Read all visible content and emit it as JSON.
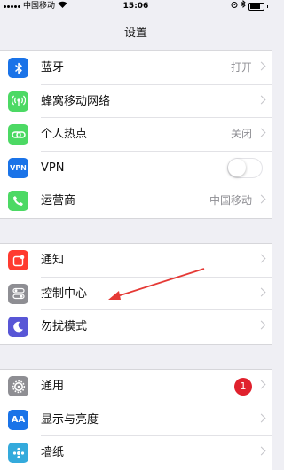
{
  "status_bar": {
    "carrier": "中国移动",
    "time": "15:06"
  },
  "nav": {
    "title": "设置"
  },
  "groups": [
    {
      "items": [
        {
          "label": "蓝牙",
          "value": "打开",
          "icon": "bluetooth-icon",
          "color": "#1a73e8"
        },
        {
          "label": "蜂窝移动网络",
          "value": "",
          "icon": "cellular-icon",
          "color": "#4cd964"
        },
        {
          "label": "个人热点",
          "value": "关闭",
          "icon": "hotspot-icon",
          "color": "#4cd964"
        },
        {
          "label": "VPN",
          "value": "",
          "icon": "vpn-icon",
          "icon_text": "VPN",
          "color": "#1a73e8",
          "toggle": false
        },
        {
          "label": "运营商",
          "value": "中国移动",
          "icon": "phone-icon",
          "color": "#4cd964"
        }
      ]
    },
    {
      "items": [
        {
          "label": "通知",
          "value": "",
          "icon": "notifications-icon",
          "color": "#ff3b30"
        },
        {
          "label": "控制中心",
          "value": "",
          "icon": "control-center-icon",
          "color": "#8e8e93"
        },
        {
          "label": "勿扰模式",
          "value": "",
          "icon": "moon-icon",
          "color": "#5856d6"
        }
      ]
    },
    {
      "items": [
        {
          "label": "通用",
          "value": "",
          "icon": "gear-icon",
          "color": "#8e8e93",
          "badge": "1"
        },
        {
          "label": "显示与亮度",
          "value": "",
          "icon": "display-icon",
          "icon_text": "AA",
          "color": "#1a73e8"
        },
        {
          "label": "墙纸",
          "value": "",
          "icon": "wallpaper-icon",
          "color": "#34aadc"
        }
      ]
    }
  ]
}
